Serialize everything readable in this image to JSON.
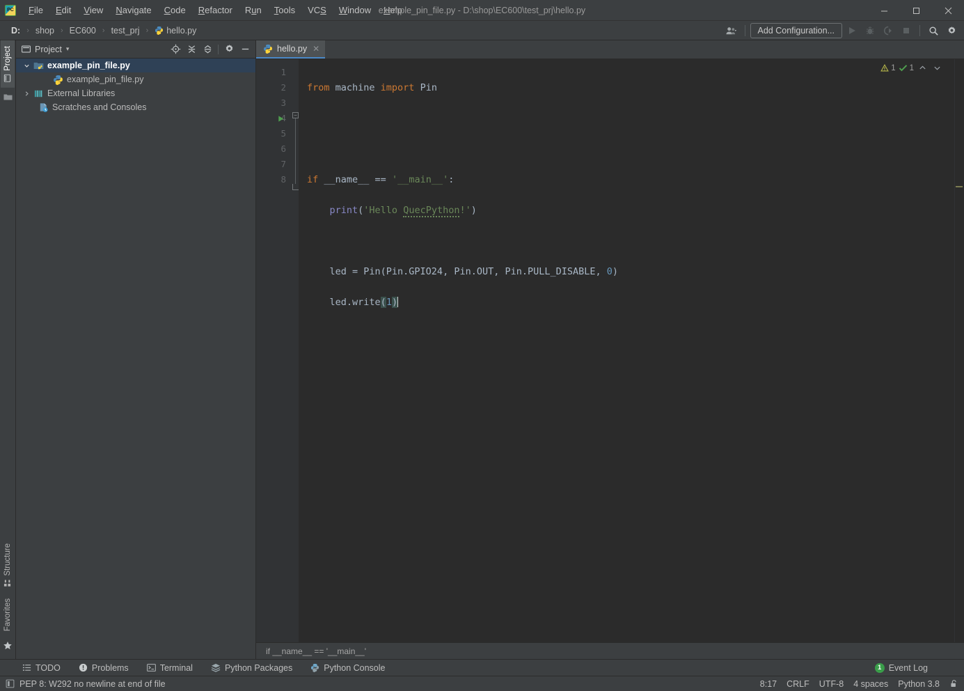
{
  "window": {
    "title": "example_pin_file.py - D:\\shop\\EC600\\test_prj\\hello.py",
    "minimize_label": "—",
    "maximize_label": "❑",
    "close_label": "✕"
  },
  "menu": {
    "items": [
      {
        "label": "File"
      },
      {
        "label": "Edit"
      },
      {
        "label": "View"
      },
      {
        "label": "Navigate"
      },
      {
        "label": "Code"
      },
      {
        "label": "Refactor"
      },
      {
        "label": "Run"
      },
      {
        "label": "Tools"
      },
      {
        "label": "VCS"
      },
      {
        "label": "Window"
      },
      {
        "label": "Help"
      }
    ]
  },
  "navbar": {
    "crumbs": [
      {
        "label": "D:",
        "icon": "drive-icon"
      },
      {
        "label": "shop",
        "icon": "folder-icon"
      },
      {
        "label": "EC600",
        "icon": "folder-icon"
      },
      {
        "label": "test_prj",
        "icon": "folder-icon"
      },
      {
        "label": "hello.py",
        "icon": "python-file-icon"
      }
    ],
    "separator": "›",
    "add_configuration_label": "Add Configuration...",
    "icons": [
      "user-group-icon",
      "run-icon",
      "debug-icon",
      "run-coverage-icon",
      "stop-icon",
      "search-icon",
      "gear-icon"
    ]
  },
  "rail": {
    "top": [
      {
        "label": "Project",
        "active": true,
        "icon": "project-icon"
      },
      {
        "label": "",
        "active": false,
        "icon": "folder-icon"
      }
    ],
    "bottom": [
      {
        "label": "Structure",
        "active": false,
        "icon": "structure-icon"
      },
      {
        "label": "Favorites",
        "active": false,
        "icon": "star-icon"
      }
    ]
  },
  "project_pane": {
    "title": "Project",
    "dropdown_caret": "▾",
    "actions": [
      "locate-icon",
      "expand-all-icon",
      "collapse-all-icon",
      "gear-icon",
      "hide-icon"
    ],
    "tree": [
      {
        "label": "example_pin_file.py",
        "depth": 0,
        "arrow": "expanded",
        "icon": "project-root-icon",
        "selected": true
      },
      {
        "label": "example_pin_file.py",
        "depth": 1,
        "arrow": "none",
        "icon": "python-file-icon",
        "selected": false
      },
      {
        "label": "External Libraries",
        "depth": 0,
        "arrow": "collapsed",
        "icon": "libraries-icon",
        "selected": false
      },
      {
        "label": "Scratches and Consoles",
        "depth": 0,
        "arrow": "none",
        "icon": "scratches-icon",
        "selected": false
      }
    ]
  },
  "editor": {
    "tabs": [
      {
        "label": "hello.py",
        "icon": "python-file-icon",
        "active": true,
        "close": "✕"
      }
    ],
    "line_numbers": [
      "1",
      "2",
      "3",
      "4",
      "5",
      "6",
      "7",
      "8"
    ],
    "code_lines": [
      "from machine import Pin",
      "",
      "",
      "if __name__ == '__main__':",
      "    print('Hello QuecPython!')",
      "",
      "    led = Pin(Pin.GPIO24, Pin.OUT, Pin.PULL_DISABLE, 0)",
      "    led.write(1)"
    ],
    "inspections": {
      "warning_count": "1",
      "check_count": "1",
      "up_caret": "⌃",
      "down_caret": "⌄"
    },
    "breadcrumb": "if __name__ == '__main__'"
  },
  "tool_windows": [
    {
      "label": "TODO",
      "icon": "todo-icon"
    },
    {
      "label": "Problems",
      "icon": "problems-icon"
    },
    {
      "label": "Terminal",
      "icon": "terminal-icon"
    },
    {
      "label": "Python Packages",
      "icon": "packages-icon"
    },
    {
      "label": "Python Console",
      "icon": "python-console-icon"
    }
  ],
  "event_log": {
    "label": "Event Log",
    "count": "1"
  },
  "statusbar": {
    "message": "PEP 8: W292 no newline at end of file",
    "message_icon": "inspection-icon",
    "caret_position": "8:17",
    "line_separator": "CRLF",
    "encoding": "UTF-8",
    "indent": "4 spaces",
    "interpreter": "Python 3.8",
    "lock_icon": "lock-icon"
  },
  "colors": {
    "chrome": "#3c3f41",
    "editor_bg": "#2b2b2b",
    "gutter_bg": "#313335",
    "selection": "#2f4156",
    "tab_accent": "#4a88c7",
    "keyword": "#cc7832",
    "string": "#6a8759",
    "number": "#6897bb",
    "function": "#8888c6",
    "default_text": "#a9b7c6",
    "badge_green": "#3a9e4a"
  }
}
